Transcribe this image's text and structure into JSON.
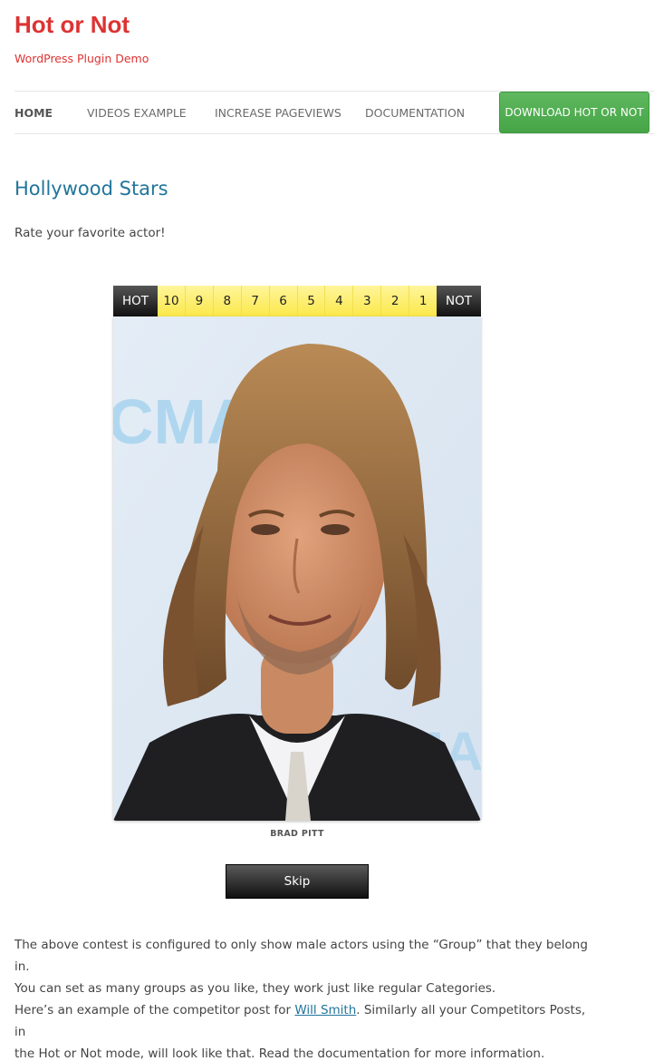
{
  "site": {
    "title": "Hot or Not",
    "tagline": "WordPress Plugin Demo"
  },
  "nav": {
    "items": [
      {
        "label": "HOME",
        "active": true
      },
      {
        "label": "VIDEOS EXAMPLE",
        "active": false
      },
      {
        "label": "INCREASE PAGEVIEWS",
        "active": false
      },
      {
        "label": "DOCUMENTATION",
        "active": false
      }
    ],
    "download_label": "DOWNLOAD HOT OR NOT"
  },
  "page": {
    "title": "Hollywood Stars",
    "intro": "Rate your favorite actor!"
  },
  "rating": {
    "hot_label": "HOT",
    "not_label": "NOT",
    "scores": [
      "10",
      "9",
      "8",
      "7",
      "6",
      "5",
      "4",
      "3",
      "2",
      "1"
    ]
  },
  "competitor": {
    "name": "BRAD PITT"
  },
  "skip_label": "Skip",
  "content": {
    "para1_line1": "The above contest is configured to only show male actors using the “Group” that they belong in.",
    "para1_line2": "You can set as many groups as you like, they work just like regular Categories.",
    "para2_before": "Here’s an example of the competitor post for ",
    "para2_link": "Will Smith",
    "para2_after_line1": ". Similarly all your Competitors Posts, in",
    "para2_line2": "the Hot or Not mode, will look like that. Read the documentation for more information."
  },
  "colors": {
    "brand": "#dd3333",
    "link": "#21759b",
    "download_button": "#4caf50",
    "rating_yellow": "#fbe84a",
    "rating_dark": "#222222"
  }
}
